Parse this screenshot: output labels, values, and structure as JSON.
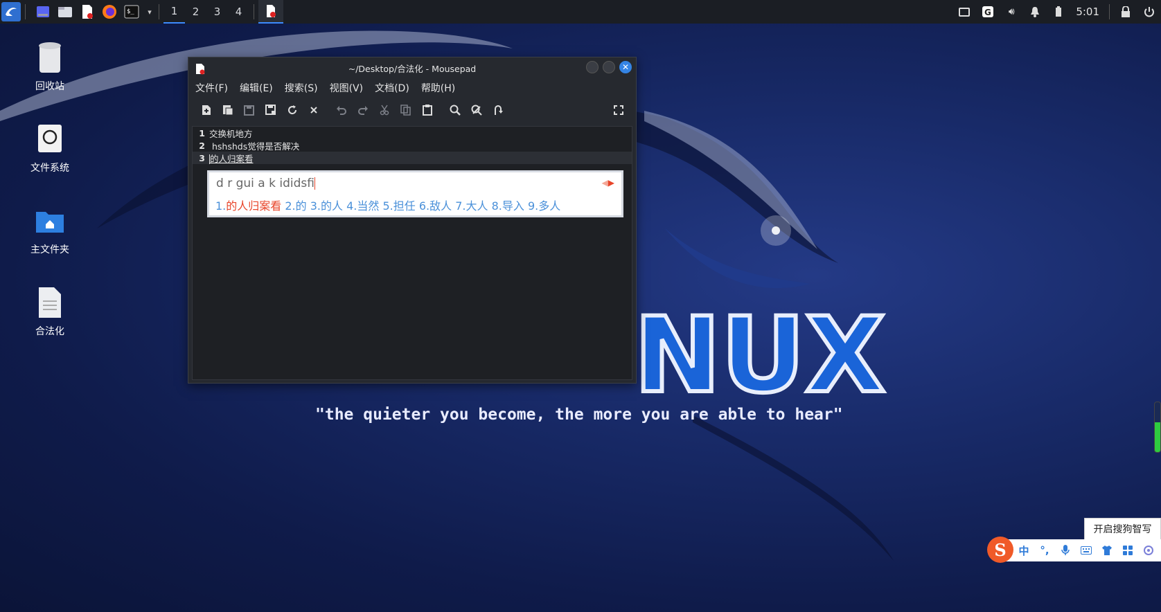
{
  "panel": {
    "launchers": [
      "kali-menu-icon",
      "show-desktop-icon",
      "file-manager-icon",
      "mousepad-launcher-icon",
      "firefox-icon",
      "terminal-icon"
    ],
    "workspaces": [
      "1",
      "2",
      "3",
      "4"
    ],
    "active_workspace": "1",
    "clock": "5:01"
  },
  "desktop_icons": {
    "trash": "回收站",
    "filesystem": "文件系统",
    "home": "主文件夹",
    "file": "合法化"
  },
  "window": {
    "title": "~/Desktop/合法化 - Mousepad",
    "menu": [
      "文件(F)",
      "编辑(E)",
      "搜索(S)",
      "视图(V)",
      "文档(D)",
      "帮助(H)"
    ],
    "lines": [
      {
        "num": "1",
        "text": "交换机地方"
      },
      {
        "num": "2",
        "text": " hshshds觉得是否解决"
      },
      {
        "num": "3",
        "text": "的人归案看"
      }
    ]
  },
  "ime": {
    "composition": "d r gui a k ididsfi",
    "candidates": [
      {
        "n": "1.",
        "w": "的人归案看"
      },
      {
        "n": "2.",
        "w": "的"
      },
      {
        "n": "3.",
        "w": "的人"
      },
      {
        "n": "4.",
        "w": "当然"
      },
      {
        "n": "5.",
        "w": "担任"
      },
      {
        "n": "6.",
        "w": "敌人"
      },
      {
        "n": "7.",
        "w": "大人"
      },
      {
        "n": "8.",
        "w": "导入"
      },
      {
        "n": "9.",
        "w": "多人"
      }
    ]
  },
  "wallpaper": {
    "logo_text": "NUX",
    "motto": "\"the quieter you become, the more you are able to hear\""
  },
  "sogou": {
    "tip": "开启搜狗智写",
    "mode": "中",
    "punct": "°,"
  },
  "colors": {
    "accent": "#3d8bfd",
    "ime_selected": "#e8452a",
    "ime_candidate": "#4a90d9",
    "sogou": "#f05a28"
  }
}
